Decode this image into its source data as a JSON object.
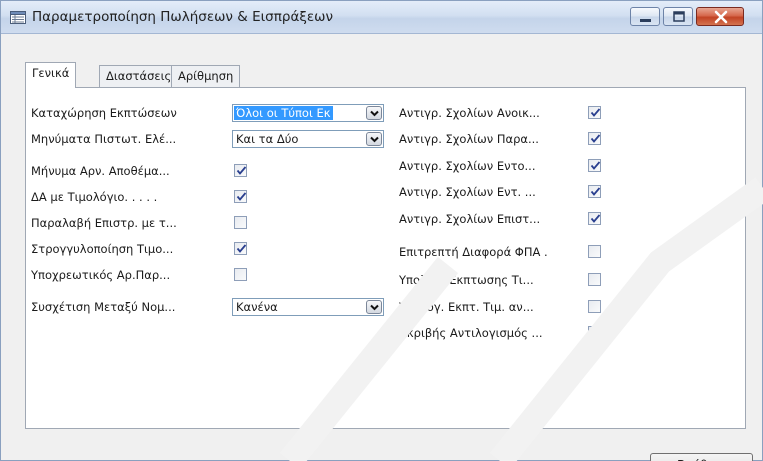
{
  "window": {
    "title": "Παραμετροποίηση Πωλήσεων & Εισπράξεων"
  },
  "tabs": [
    {
      "label": "Γενικά",
      "active": true
    },
    {
      "label": "Διαστάσεις",
      "active": false
    },
    {
      "label": "Αρίθμηση",
      "active": false
    }
  ],
  "left_fields": [
    {
      "label": "Καταχώρηση Εκπτώσεων",
      "type": "combo",
      "value": "Όλοι οι Τύποι Εκ"
    },
    {
      "label": "Μηνύματα Πιστωτ. Ελέ...",
      "type": "combo",
      "value": "Και τα Δύο"
    },
    {
      "label": "Μήνυμα Αρν. Αποθέμα...",
      "type": "checkbox",
      "checked": true
    },
    {
      "label": "ΔΑ με Τιμολόγιο. . . . .",
      "type": "checkbox",
      "checked": true
    },
    {
      "label": "Παραλαβή Επιστρ. με τ...",
      "type": "checkbox",
      "checked": false
    },
    {
      "label": "Στρογγυλοποίηση Τιμο...",
      "type": "checkbox",
      "checked": true
    },
    {
      "label": "Υποχρεωτικός Αρ.Παρ...",
      "type": "checkbox",
      "checked": false
    },
    {
      "label": "Συσχέτιση Μεταξύ Νομ...",
      "type": "combo",
      "value": "Κανένα"
    }
  ],
  "right_fields": [
    {
      "label": "Αντιγρ. Σχολίων Ανοικ...",
      "checked": true
    },
    {
      "label": "Αντιγρ. Σχολίων Παρα...",
      "checked": true
    },
    {
      "label": "Αντιγρ. Σχολίων Εντο...",
      "checked": true
    },
    {
      "label": "Αντιγρ. Σχολίων Εντ. ...",
      "checked": true
    },
    {
      "label": "Αντιγρ. Σχολίων Επιστ...",
      "checked": true
    },
    {
      "label": "Επιτρεπτή Διαφορά ΦΠΑ .",
      "checked": false
    },
    {
      "label": "Υπολογ. Έκπτωσης Τι...",
      "checked": false
    },
    {
      "label": "Υπολογ. Εκπτ. Τιμ. αν...",
      "checked": false
    },
    {
      "label": "Ακριβής Αντιλογισμός ...",
      "checked": false
    }
  ],
  "buttons": {
    "help": "Βοήθεια"
  },
  "colors": {
    "titlebar": "#d2dff1",
    "selection": "#3399ff",
    "close_button": "#c24325"
  }
}
